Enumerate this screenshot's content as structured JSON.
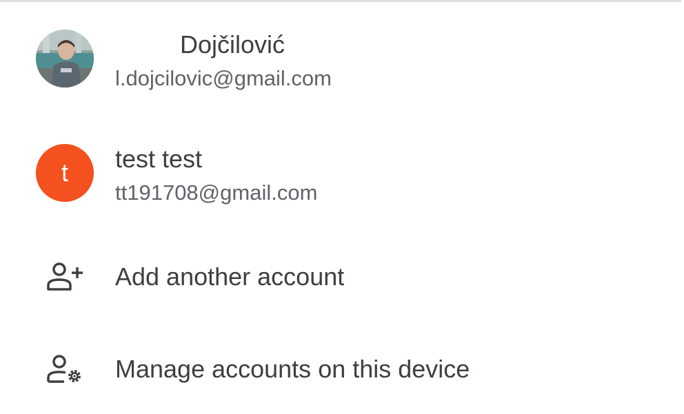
{
  "accounts": [
    {
      "name": "Dojčilović",
      "email": "l.dojcilovic@gmail.com",
      "avatar": "profile-photo",
      "avatar_letter": ""
    },
    {
      "name": "test test",
      "email": "tt191708@gmail.com",
      "avatar": "letter",
      "avatar_letter": "t",
      "avatar_color": "#f4511e"
    }
  ],
  "actions": [
    {
      "label": "Add another account",
      "icon": "person-add-icon"
    },
    {
      "label": "Manage accounts on this device",
      "icon": "manage-accounts-icon"
    }
  ],
  "colors": {
    "primary_text": "#3c4043",
    "secondary_text": "#5f6368",
    "divider": "#dadce0"
  }
}
